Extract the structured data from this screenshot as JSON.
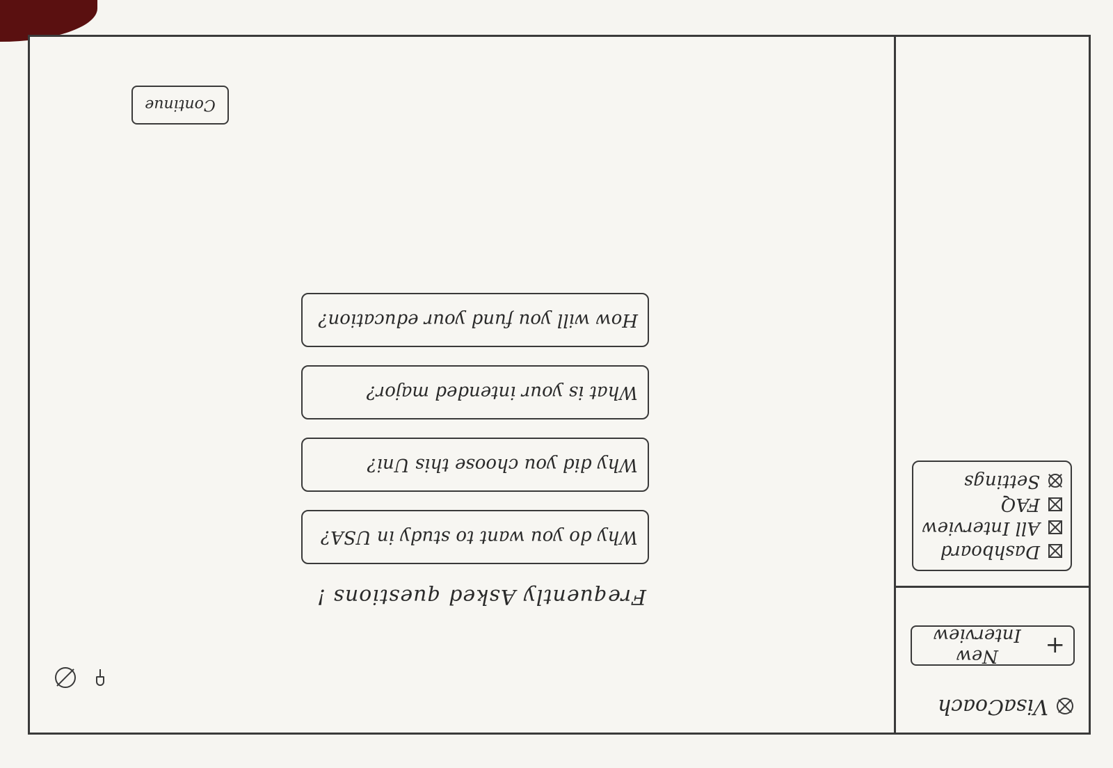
{
  "sidebar": {
    "brand": "VisaCoach",
    "new_interview_label": "New Interview",
    "menu": [
      {
        "label": "Dashboard",
        "icon": "x-square-icon"
      },
      {
        "label": "All Interview",
        "icon": "x-square-icon"
      },
      {
        "label": "FAQ",
        "icon": "x-square-icon"
      },
      {
        "label": "Settings",
        "icon": "x-circle-icon"
      }
    ]
  },
  "header": {
    "icons": [
      "bell-icon",
      "profile-icon"
    ]
  },
  "main": {
    "faq_title": "Frequently Asked questions !",
    "faq_items": [
      "Why do you want to study in USA?",
      "Why did you choose this Uni?",
      "What is your intended major?",
      "How will you fund your education?"
    ],
    "continue_label": "Continue"
  },
  "colors": {
    "ink": "#3a3a3a",
    "paper": "#f6f5f1"
  }
}
